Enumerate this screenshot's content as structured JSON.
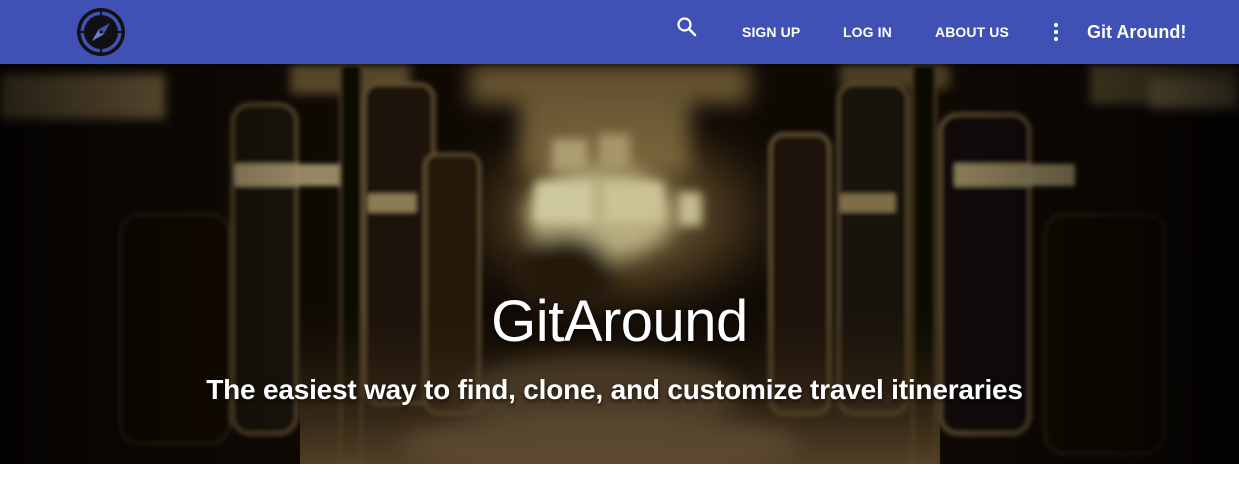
{
  "colors": {
    "navbar_bg": "#3f51b5",
    "nav_text": "#ffffff",
    "hero_text": "#ffffff",
    "page_bg": "#ffffff"
  },
  "navbar": {
    "logo_icon": "compass-icon",
    "search_icon": "search-icon",
    "links": {
      "sign_up": "SIGN UP",
      "log_in": "LOG IN",
      "about_us": "ABOUT US"
    },
    "more_icon": "more-vert-icon",
    "brand": "Git Around!"
  },
  "hero": {
    "background": "blurred-subway-car-interior-image",
    "title": "GitAround",
    "subtitle": "The easiest way to find, clone, and customize travel itineraries"
  }
}
